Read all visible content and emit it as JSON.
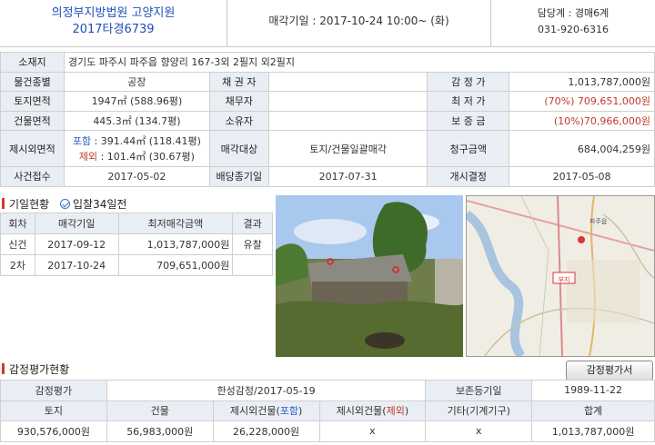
{
  "header": {
    "court": "의정부지방법원 고양지원",
    "case_no": "2017타경6739",
    "sale_label": "매각기일",
    "sale_date": "2017-10-24 10:00~ (화)",
    "manager": "담당계 : 경매6계",
    "phone": "031-920-6316"
  },
  "info": {
    "addr_label": "소재지",
    "address": "경기도 파주시 파주읍 향양리 167-3외 2필지",
    "address_extra": "외2필지",
    "type_label": "물건종별",
    "type": "공장",
    "creditor_label": "채 권 자",
    "creditor": "",
    "appraisal_label": "감 정 가",
    "appraisal": "1,013,787,000원",
    "land_label": "토지면적",
    "land_area": "1947㎡ (588.96평)",
    "debtor_label": "채무자",
    "debtor": "",
    "min_label": "최 저 가",
    "min_price": "(70%) 709,651,000원",
    "bldg_label": "건물면적",
    "bldg_area": "445.3㎡ (134.7평)",
    "owner_label": "소유자",
    "owner": "",
    "deposit_label": "보 증 금",
    "deposit": "(10%)70,966,000원",
    "excl_label": "제시외면적",
    "incl_tag": "포함",
    "incl_value": " : 391.44㎡ (118.41평)",
    "excl_tag": "제외",
    "excl_value": " : 101.4㎡ (30.67평)",
    "target_label": "매각대상",
    "target": "토지/건물일괄매각",
    "claim_label": "청구금액",
    "claim": "684,004,259원",
    "received_label": "사건접수",
    "received": "2017-05-02",
    "dist_label": "배당종기일",
    "dist_date": "2017-07-31",
    "start_label": "개시결정",
    "start_date": "2017-05-08"
  },
  "history": {
    "title": "기일현황",
    "bid_note": "입찰34일전",
    "headers": [
      "회차",
      "매각기일",
      "최저매각금액",
      "결과"
    ],
    "rows": [
      [
        "신건",
        "2017-09-12",
        "1,013,787,000원",
        "유찰"
      ],
      [
        "2차",
        "2017-10-24",
        "709,651,000원",
        ""
      ]
    ]
  },
  "appraisal_section": {
    "title": "감정평가현황",
    "button": "감정평가서",
    "row1": {
      "label": "감정평가",
      "company": "한성감정/2017-05-19",
      "keep_label": "보존등기일",
      "keep_date": "1989-11-22"
    },
    "cols": [
      "토지",
      "건물",
      "제시외건물(",
      "포함",
      ")",
      "제시외건물(",
      "제외",
      ")",
      "기타(기계기구)",
      "합계"
    ],
    "values": [
      "930,576,000원",
      "56,983,000원",
      "26,228,000원",
      "x",
      "x",
      "1,013,787,000원"
    ]
  },
  "map": {
    "place_label": "파주읍",
    "marker_label": "부지"
  },
  "colors": {
    "accent": "#d83a2a",
    "link": "#1f4fb8",
    "label_bg": "#e9eef4"
  }
}
